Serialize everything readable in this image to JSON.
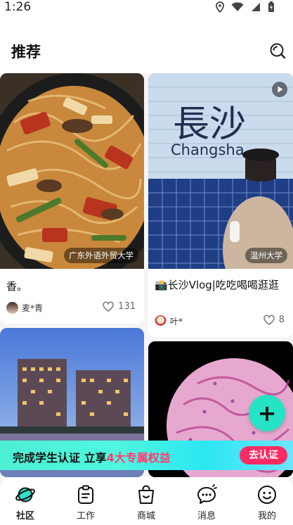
{
  "status": {
    "time": "1:26"
  },
  "header": {
    "title": "推荐",
    "search_icon": "search-icon"
  },
  "posts": [
    {
      "location": "广东外语外贸大学",
      "title": "香。",
      "author": "麦*青",
      "likes": "131"
    },
    {
      "location": "温州大学",
      "title": "📸长沙Vlog|吃吃喝喝逛逛",
      "author": "叶*",
      "likes": "8",
      "sign_text": "長沙",
      "sign_text_en": "Changsha"
    },
    {
      "location": "",
      "title": "",
      "author": "",
      "likes": ""
    },
    {
      "location": "",
      "title": "",
      "author": "",
      "likes": ""
    }
  ],
  "fab": {
    "label": "+"
  },
  "banner": {
    "text_prefix": "完成学生认证 立享",
    "text_highlight": "4大专属权益",
    "cta": "去认证"
  },
  "tabbar": [
    {
      "label": "社区",
      "icon": "planet-icon",
      "active": true
    },
    {
      "label": "工作",
      "icon": "clipboard-icon",
      "active": false
    },
    {
      "label": "商城",
      "icon": "shopping-bag-icon",
      "active": false
    },
    {
      "label": "消息",
      "icon": "chat-bubble-icon",
      "active": false
    },
    {
      "label": "我的",
      "icon": "smiley-icon",
      "active": false
    }
  ],
  "colors": {
    "accent": "#27e3c6",
    "cta": "#ff2b63",
    "highlight": "#ff3d6e"
  }
}
